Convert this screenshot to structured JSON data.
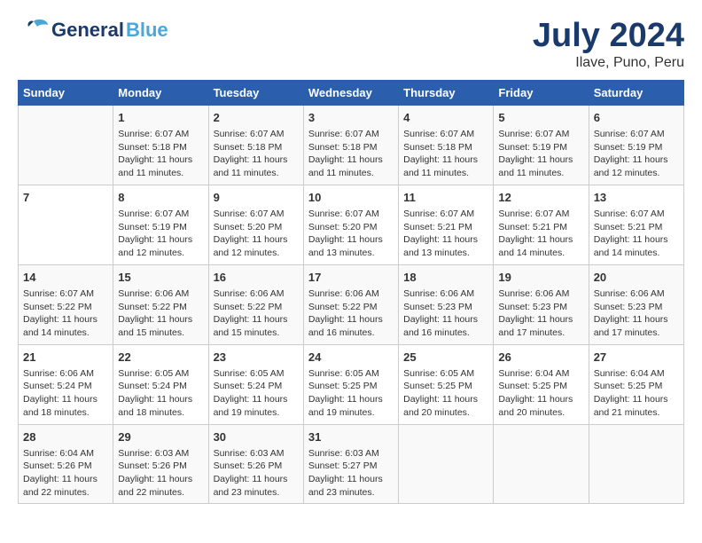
{
  "logo": {
    "general": "General",
    "blue": "Blue"
  },
  "title": {
    "month_year": "July 2024",
    "location": "Ilave, Puno, Peru"
  },
  "weekdays": [
    "Sunday",
    "Monday",
    "Tuesday",
    "Wednesday",
    "Thursday",
    "Friday",
    "Saturday"
  ],
  "weeks": [
    [
      {
        "day": "",
        "info": ""
      },
      {
        "day": "1",
        "info": "Sunrise: 6:07 AM\nSunset: 5:18 PM\nDaylight: 11 hours\nand 11 minutes."
      },
      {
        "day": "2",
        "info": "Sunrise: 6:07 AM\nSunset: 5:18 PM\nDaylight: 11 hours\nand 11 minutes."
      },
      {
        "day": "3",
        "info": "Sunrise: 6:07 AM\nSunset: 5:18 PM\nDaylight: 11 hours\nand 11 minutes."
      },
      {
        "day": "4",
        "info": "Sunrise: 6:07 AM\nSunset: 5:18 PM\nDaylight: 11 hours\nand 11 minutes."
      },
      {
        "day": "5",
        "info": "Sunrise: 6:07 AM\nSunset: 5:19 PM\nDaylight: 11 hours\nand 11 minutes."
      },
      {
        "day": "6",
        "info": "Sunrise: 6:07 AM\nSunset: 5:19 PM\nDaylight: 11 hours\nand 12 minutes."
      }
    ],
    [
      {
        "day": "7",
        "info": ""
      },
      {
        "day": "8",
        "info": "Sunrise: 6:07 AM\nSunset: 5:19 PM\nDaylight: 11 hours\nand 12 minutes."
      },
      {
        "day": "9",
        "info": "Sunrise: 6:07 AM\nSunset: 5:20 PM\nDaylight: 11 hours\nand 12 minutes."
      },
      {
        "day": "10",
        "info": "Sunrise: 6:07 AM\nSunset: 5:20 PM\nDaylight: 11 hours\nand 13 minutes."
      },
      {
        "day": "11",
        "info": "Sunrise: 6:07 AM\nSunset: 5:21 PM\nDaylight: 11 hours\nand 13 minutes."
      },
      {
        "day": "12",
        "info": "Sunrise: 6:07 AM\nSunset: 5:21 PM\nDaylight: 11 hours\nand 14 minutes."
      },
      {
        "day": "13",
        "info": "Sunrise: 6:07 AM\nSunset: 5:21 PM\nDaylight: 11 hours\nand 14 minutes."
      }
    ],
    [
      {
        "day": "14",
        "info": "Sunrise: 6:07 AM\nSunset: 5:22 PM\nDaylight: 11 hours\nand 14 minutes."
      },
      {
        "day": "15",
        "info": "Sunrise: 6:06 AM\nSunset: 5:22 PM\nDaylight: 11 hours\nand 15 minutes."
      },
      {
        "day": "16",
        "info": "Sunrise: 6:06 AM\nSunset: 5:22 PM\nDaylight: 11 hours\nand 15 minutes."
      },
      {
        "day": "17",
        "info": "Sunrise: 6:06 AM\nSunset: 5:22 PM\nDaylight: 11 hours\nand 16 minutes."
      },
      {
        "day": "18",
        "info": "Sunrise: 6:06 AM\nSunset: 5:23 PM\nDaylight: 11 hours\nand 16 minutes."
      },
      {
        "day": "19",
        "info": "Sunrise: 6:06 AM\nSunset: 5:23 PM\nDaylight: 11 hours\nand 17 minutes."
      },
      {
        "day": "20",
        "info": "Sunrise: 6:06 AM\nSunset: 5:23 PM\nDaylight: 11 hours\nand 17 minutes."
      }
    ],
    [
      {
        "day": "21",
        "info": "Sunrise: 6:06 AM\nSunset: 5:24 PM\nDaylight: 11 hours\nand 18 minutes."
      },
      {
        "day": "22",
        "info": "Sunrise: 6:05 AM\nSunset: 5:24 PM\nDaylight: 11 hours\nand 18 minutes."
      },
      {
        "day": "23",
        "info": "Sunrise: 6:05 AM\nSunset: 5:24 PM\nDaylight: 11 hours\nand 19 minutes."
      },
      {
        "day": "24",
        "info": "Sunrise: 6:05 AM\nSunset: 5:25 PM\nDaylight: 11 hours\nand 19 minutes."
      },
      {
        "day": "25",
        "info": "Sunrise: 6:05 AM\nSunset: 5:25 PM\nDaylight: 11 hours\nand 20 minutes."
      },
      {
        "day": "26",
        "info": "Sunrise: 6:04 AM\nSunset: 5:25 PM\nDaylight: 11 hours\nand 20 minutes."
      },
      {
        "day": "27",
        "info": "Sunrise: 6:04 AM\nSunset: 5:25 PM\nDaylight: 11 hours\nand 21 minutes."
      }
    ],
    [
      {
        "day": "28",
        "info": "Sunrise: 6:04 AM\nSunset: 5:26 PM\nDaylight: 11 hours\nand 22 minutes."
      },
      {
        "day": "29",
        "info": "Sunrise: 6:03 AM\nSunset: 5:26 PM\nDaylight: 11 hours\nand 22 minutes."
      },
      {
        "day": "30",
        "info": "Sunrise: 6:03 AM\nSunset: 5:26 PM\nDaylight: 11 hours\nand 23 minutes."
      },
      {
        "day": "31",
        "info": "Sunrise: 6:03 AM\nSunset: 5:27 PM\nDaylight: 11 hours\nand 23 minutes."
      },
      {
        "day": "",
        "info": ""
      },
      {
        "day": "",
        "info": ""
      },
      {
        "day": "",
        "info": ""
      }
    ]
  ]
}
